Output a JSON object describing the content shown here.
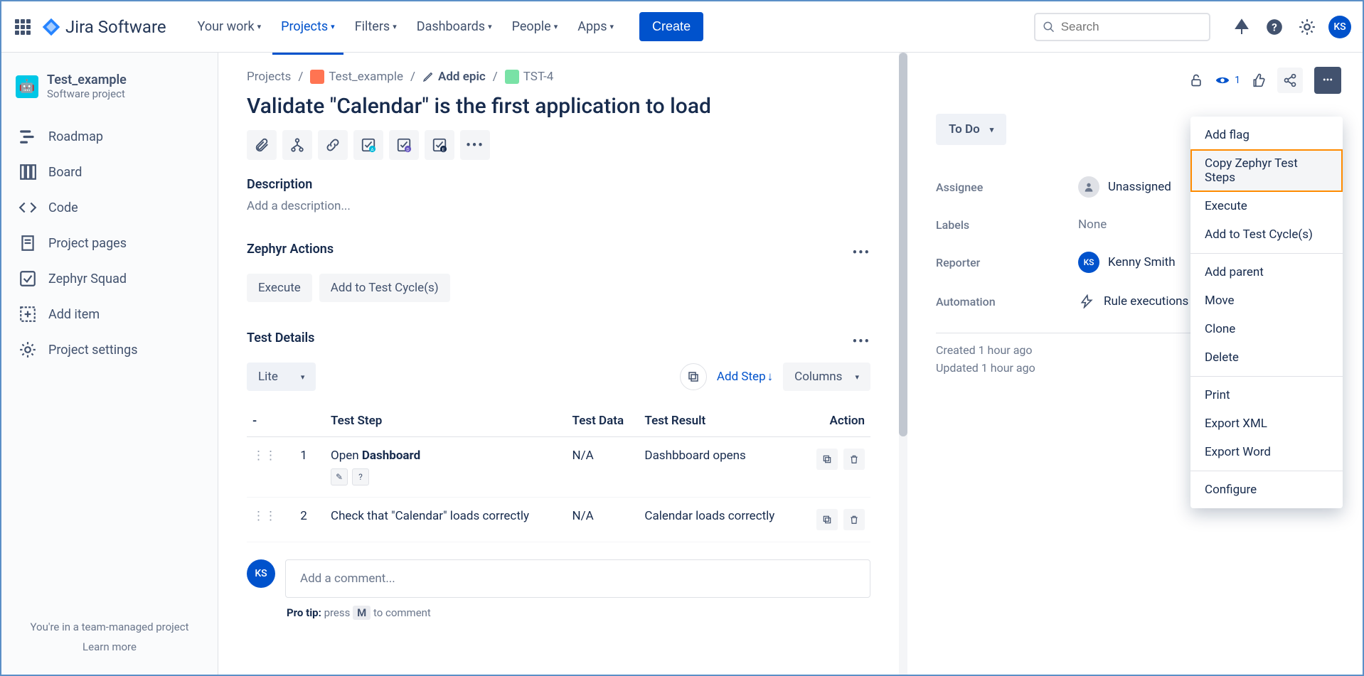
{
  "topnav": {
    "product": "Jira Software",
    "links": [
      "Your work",
      "Projects",
      "Filters",
      "Dashboards",
      "People",
      "Apps"
    ],
    "active_index": 1,
    "create_label": "Create",
    "search_placeholder": "Search",
    "avatar_initials": "KS"
  },
  "sidebar": {
    "project_name": "Test_example",
    "project_type": "Software project",
    "items": [
      "Roadmap",
      "Board",
      "Code",
      "Project pages",
      "Zephyr Squad",
      "Add item",
      "Project settings"
    ],
    "footer_line1": "You're in a team-managed project",
    "footer_line2": "Learn more"
  },
  "breadcrumb": {
    "projects": "Projects",
    "project": "Test_example",
    "add_epic": "Add epic",
    "issue_key": "TST-4"
  },
  "issue": {
    "title": "Validate \"Calendar\" is the first application to load",
    "description_label": "Description",
    "description_placeholder": "Add a description..."
  },
  "zephyr": {
    "heading": "Zephyr Actions",
    "execute": "Execute",
    "add_to_cycle": "Add to Test Cycle(s)"
  },
  "test_details": {
    "heading": "Test Details",
    "view_mode": "Lite",
    "add_step": "Add Step",
    "columns": "Columns",
    "headers": {
      "blank": "-",
      "step": "Test Step",
      "data": "Test Data",
      "result": "Test Result",
      "action": "Action"
    },
    "rows": [
      {
        "num": "1",
        "step_prefix": "Open ",
        "step_bold": "Dashboard",
        "step_suffix": "",
        "data": "N/A",
        "result": "Dashbboard opens",
        "show_icons": true
      },
      {
        "num": "2",
        "step_prefix": "Check that \"Calendar\" loads correctly",
        "step_bold": "",
        "step_suffix": "",
        "data": "N/A",
        "result": "Calendar loads correctly",
        "show_icons": false
      }
    ]
  },
  "comment": {
    "placeholder": "Add a comment...",
    "avatar": "KS",
    "protip_bold": "Pro tip:",
    "protip_before": " press ",
    "protip_key": "M",
    "protip_after": " to comment"
  },
  "right_panel": {
    "watchers": "1",
    "status": "To Do",
    "fields": {
      "assignee_label": "Assignee",
      "assignee_value": "Unassigned",
      "labels_label": "Labels",
      "labels_value": "None",
      "reporter_label": "Reporter",
      "reporter_value": "Kenny Smith",
      "reporter_initials": "KS",
      "automation_label": "Automation",
      "automation_value": "Rule executions"
    },
    "created": "Created 1 hour ago",
    "updated": "Updated 1 hour ago"
  },
  "menu": {
    "items_group1": [
      "Add flag",
      "Copy Zephyr Test Steps",
      "Execute",
      "Add to Test Cycle(s)"
    ],
    "items_group2": [
      "Add parent",
      "Move",
      "Clone",
      "Delete"
    ],
    "items_group3": [
      "Print",
      "Export XML",
      "Export Word"
    ],
    "items_group4": [
      "Configure"
    ],
    "highlighted_index": 1
  }
}
